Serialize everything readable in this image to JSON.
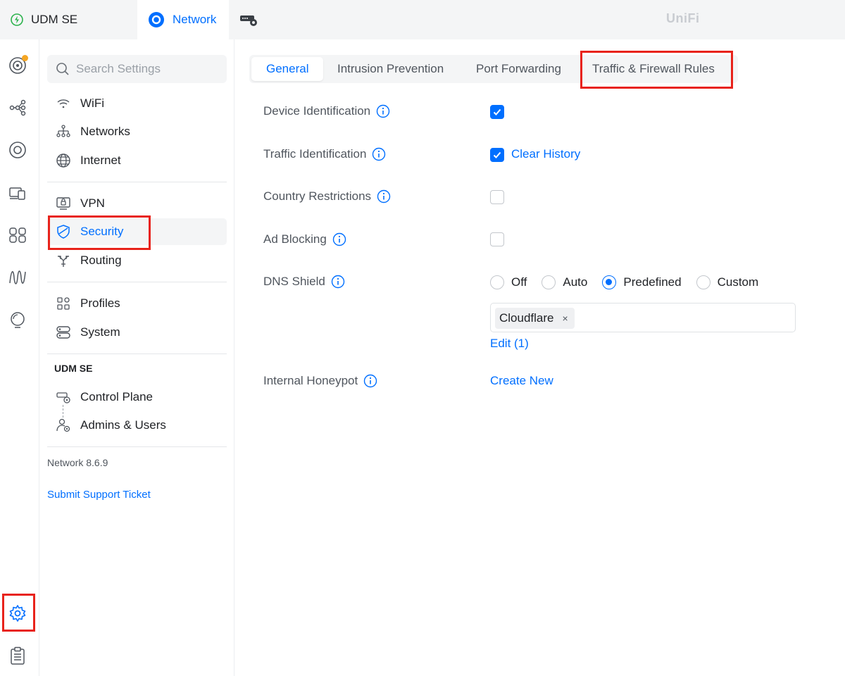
{
  "topbar": {
    "console_name": "UDM SE",
    "app_name": "Network",
    "brand": "UniFi",
    "icons": [
      "bolt-icon",
      "network-app-icon",
      "device-config-icon"
    ],
    "accent_color": "#006fff"
  },
  "rail": {
    "items": [
      "dashboard-icon",
      "topology-icon",
      "unifi-devices-icon",
      "client-devices-icon",
      "ports-icon",
      "radio-manager-icon",
      "insights-icon",
      "settings-icon",
      "logs-icon"
    ],
    "active": "settings-icon"
  },
  "sidebar": {
    "search_placeholder": "Search Settings",
    "items": [
      {
        "label": "WiFi",
        "icon": "wifi-icon"
      },
      {
        "label": "Networks",
        "icon": "networks-icon"
      },
      {
        "label": "Internet",
        "icon": "globe-icon"
      },
      {
        "label": "VPN",
        "icon": "vpn-icon"
      },
      {
        "label": "Security",
        "icon": "shield-icon"
      },
      {
        "label": "Routing",
        "icon": "routing-icon"
      },
      {
        "label": "Profiles",
        "icon": "profiles-icon"
      },
      {
        "label": "System",
        "icon": "system-icon"
      }
    ],
    "active": "Security",
    "section_title": "UDM SE",
    "section_items": [
      {
        "label": "Control Plane",
        "icon": "control-plane-icon"
      },
      {
        "label": "Admins & Users",
        "icon": "admins-icon"
      }
    ],
    "version": "Network 8.6.9",
    "support_link": "Submit Support Ticket"
  },
  "tabs": {
    "items": [
      "General",
      "Intrusion Prevention",
      "Port Forwarding",
      "Traffic & Firewall Rules"
    ],
    "selected": "General"
  },
  "settings": {
    "device_identification": {
      "label": "Device Identification",
      "checked": true
    },
    "traffic_identification": {
      "label": "Traffic Identification",
      "checked": true,
      "action": "Clear History"
    },
    "country_restrictions": {
      "label": "Country Restrictions",
      "checked": false
    },
    "ad_blocking": {
      "label": "Ad Blocking",
      "checked": false
    },
    "dns_shield": {
      "label": "DNS Shield",
      "options": [
        "Off",
        "Auto",
        "Predefined",
        "Custom"
      ],
      "selected": "Predefined",
      "servers": [
        "Cloudflare"
      ],
      "remove_glyph": "×",
      "edit_link": "Edit (1)"
    },
    "internal_honeypot": {
      "label": "Internal Honeypot",
      "action": "Create New"
    }
  },
  "highlight_color": "#e8231b"
}
